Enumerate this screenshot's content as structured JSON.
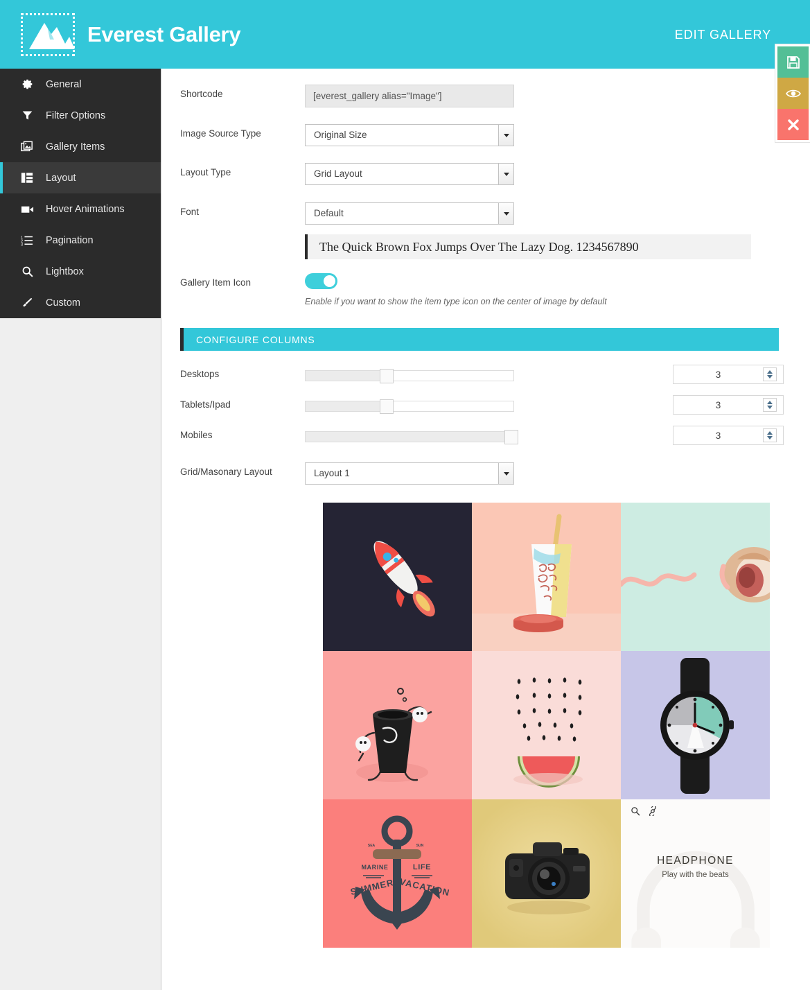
{
  "header": {
    "brand": "Everest Gallery",
    "title": "EDIT GALLERY",
    "logo_icon": "mountain-logo-icon"
  },
  "actions": [
    {
      "name": "save",
      "icon": "floppy-disk-icon",
      "color": "#53bf96"
    },
    {
      "name": "preview",
      "icon": "eye-icon",
      "color": "#cfa844"
    },
    {
      "name": "close",
      "icon": "close-x-icon",
      "color": "#f9746c"
    }
  ],
  "sidebar": {
    "items": [
      {
        "label": "General",
        "icon": "gear-icon",
        "active": false
      },
      {
        "label": "Filter Options",
        "icon": "funnel-icon",
        "active": false
      },
      {
        "label": "Gallery Items",
        "icon": "images-stack-icon",
        "active": false
      },
      {
        "label": "Layout",
        "icon": "layout-grid-icon",
        "active": true
      },
      {
        "label": "Hover Animations",
        "icon": "video-camera-icon",
        "active": false
      },
      {
        "label": "Pagination",
        "icon": "ordered-list-icon",
        "active": false
      },
      {
        "label": "Lightbox",
        "icon": "magnifier-icon",
        "active": false
      },
      {
        "label": "Custom",
        "icon": "paint-brush-icon",
        "active": false
      }
    ]
  },
  "form": {
    "shortcode": {
      "label": "Shortcode",
      "value": "[everest_gallery alias=\"Image\"]"
    },
    "image_source_type": {
      "label": "Image Source Type",
      "value": "Original Size"
    },
    "layout_type": {
      "label": "Layout Type",
      "value": "Grid Layout"
    },
    "font": {
      "label": "Font",
      "value": "Default"
    },
    "font_preview": "The Quick Brown Fox Jumps Over The Lazy Dog. 1234567890",
    "gallery_item_icon": {
      "label": "Gallery Item Icon",
      "state": "on",
      "hint": "Enable if you want to show the item type icon on the center of image by default"
    },
    "grid_masonry_layout": {
      "label": "Grid/Masonary Layout",
      "value": "Layout 1"
    }
  },
  "configure_columns": {
    "section_title": "CONFIGURE COLUMNS",
    "rows": [
      {
        "label": "Desktops",
        "value": "3",
        "slider_percent": 39
      },
      {
        "label": "Tablets/Ipad",
        "value": "3",
        "slider_percent": 39
      },
      {
        "label": "Mobiles",
        "value": "3",
        "slider_percent": 99
      }
    ]
  },
  "preview_grid": {
    "tiles": [
      {
        "name": "rocket",
        "bg": "#252434",
        "caption": ""
      },
      {
        "name": "paper-cup",
        "bg": "#fbc7b5",
        "caption": ""
      },
      {
        "name": "headphones-mint",
        "bg": "#cdece2",
        "caption": ""
      },
      {
        "name": "coffee-cup-character",
        "bg": "#fba3a0",
        "caption": ""
      },
      {
        "name": "watermelon-smile",
        "bg": "#fadcd8",
        "caption": ""
      },
      {
        "name": "wrist-watch",
        "bg": "#c7c6e8",
        "caption": ""
      },
      {
        "name": "anchor-marine",
        "bg": "#fb7f7c",
        "caption_lines": [
          "MARINE",
          "LIFE",
          "SUMMER",
          "VACATION"
        ]
      },
      {
        "name": "dslr-camera",
        "bg": "#e6cf82",
        "caption": ""
      },
      {
        "name": "headphone-card",
        "bg": "#fcfbfa",
        "title": "HEADPHONE",
        "subtitle": "Play with the beats",
        "icons": [
          "magnifier-icon",
          "link-icon"
        ]
      }
    ]
  },
  "colors": {
    "brand_teal": "#33c7d9",
    "sidebar_dark": "#2b2b2b",
    "toggle_on": "#3ecfdb"
  }
}
